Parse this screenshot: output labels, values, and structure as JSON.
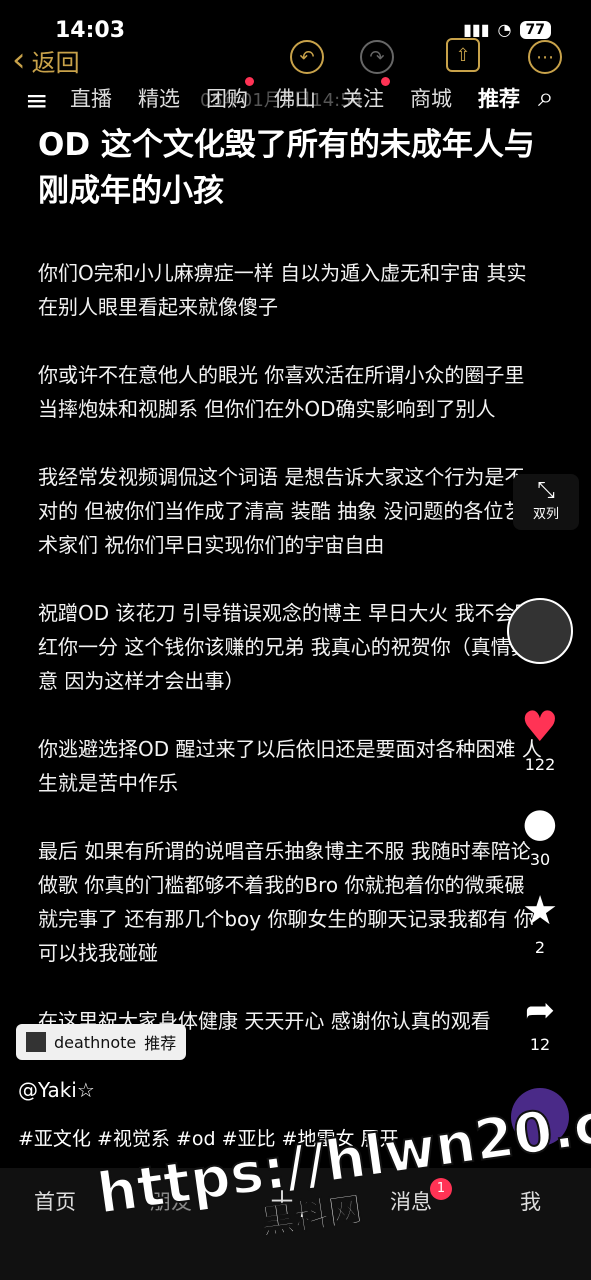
{
  "status": {
    "time": "14:03",
    "battery": "77"
  },
  "header": {
    "back_label": "返回"
  },
  "tabs": [
    "直播",
    "精选",
    "团购",
    "佛山",
    "关注",
    "商城",
    "推荐"
  ],
  "faded_date": "05年01月2日14:54",
  "title": "OD 这个文化毁了所有的未成年人与刚成年的小孩",
  "paragraphs": [
    "你们O完和小儿麻痹症一样 自以为遁入虚无和宇宙 其实在别人眼里看起来就像傻子",
    "你或许不在意他人的眼光 你喜欢活在所谓小众的圈子里当摔炮妹和视脚系 但你们在外OD确实影响到了别人",
    "我经常发视频调侃这个词语 是想告诉大家这个行为是不对的 但被你们当作成了清高 装酷 抽象 没问题的各位艺术家们 祝你们早日实现你们的宇宙自由",
    "祝蹭OD 该花刀 引导错误观念的博主 早日大火 我不会眼红你一分 这个钱你该赚的兄弟 我真心的祝贺你（真情真意 因为这样才会出事）",
    "你逃避选择OD 醒过来了以后依旧还是要面对各种困难 人生就是苦中作乐",
    "最后 如果有所谓的说唱音乐抽象博主不服 我随时奉陪论做歌 你真的门槛都够不着我的Bro 你就抱着你的微乘碾就完事了 还有那几个boy 你聊女生的聊天记录我都有 你可以找我碰碰",
    "在这里祝大家身体健康 天天开心 感谢你认真的观看"
  ],
  "side": {
    "double_label": "双列",
    "likes": "122",
    "comments": "30",
    "stars": "2",
    "shares": "12"
  },
  "rec_card": {
    "name": "deathnote",
    "suffix": "推荐"
  },
  "author": "@Yaki☆",
  "tags": "#亚文化 #视觉系 #od #亚比 #地雷女 展开",
  "bottom_nav": {
    "home": "首页",
    "friends": "朋友",
    "messages": "消息",
    "me": "我",
    "msg_badge": "1"
  },
  "watermark": {
    "url": "https://hlwn20.com",
    "cn": "黑料网"
  }
}
